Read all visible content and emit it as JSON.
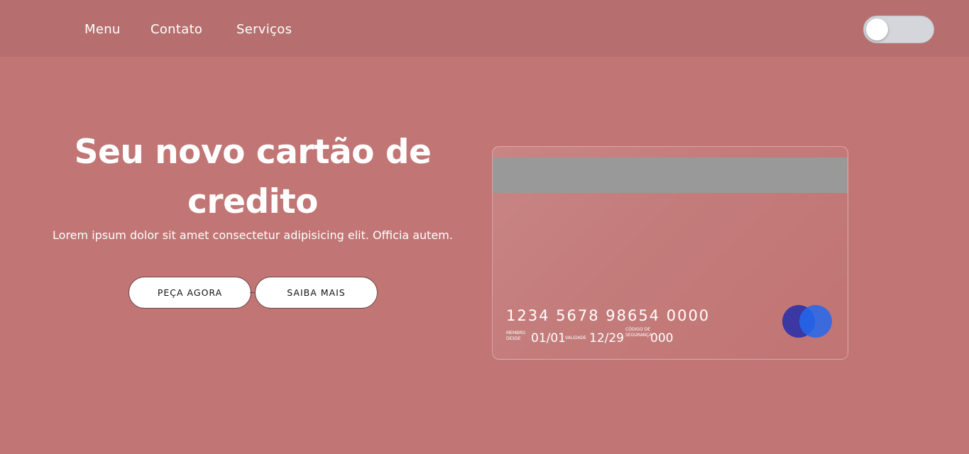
{
  "nav": {
    "items": [
      "Menu",
      "Contato",
      "Serviços"
    ]
  },
  "theme_toggle": {
    "state": "off"
  },
  "hero": {
    "title": "Seu novo cartão de credito",
    "text": "Lorem ipsum dolor sit amet consectetur adipisicing elit. Officia autem.",
    "buttons": [
      "PEÇA AGORA",
      "SAIBA MAIS"
    ]
  },
  "card": {
    "number": "1234 5678 98654 0000",
    "member_label": "MEMBRO DESDE",
    "member_value": "01/01",
    "validity_label": "VALIDADE",
    "validity_value": "12/29",
    "cvc_label": "CÓDIGO DE SEGURANÇA",
    "cvc_value": "000",
    "logo": "card-brand-circles-icon"
  },
  "colors": {
    "background": "#c17574",
    "navbar": "#b66f6e",
    "stripe": "#999999",
    "logo_left": "#3b37a3",
    "logo_right": "#2368f0"
  }
}
